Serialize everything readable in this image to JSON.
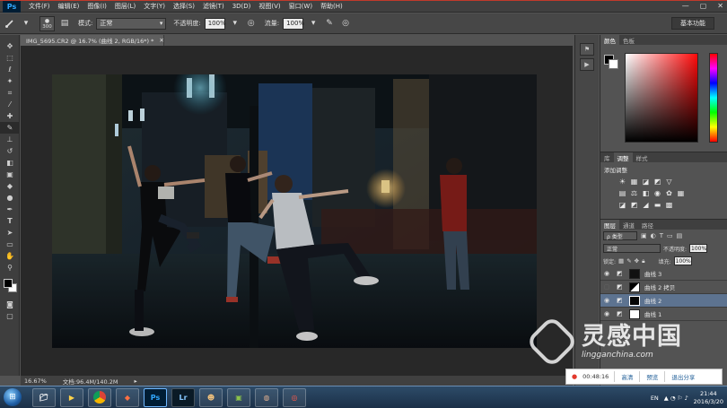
{
  "app": {
    "logo": "Ps"
  },
  "menu": [
    "文件(F)",
    "编辑(E)",
    "图像(I)",
    "图层(L)",
    "文字(Y)",
    "选择(S)",
    "滤镜(T)",
    "3D(D)",
    "视图(V)",
    "窗口(W)",
    "帮助(H)"
  ],
  "window_controls": [
    "—",
    "▢",
    "✕"
  ],
  "options_bar": {
    "brush_size": "300",
    "mode_label": "模式:",
    "mode_value": "正常",
    "opacity_label": "不透明度:",
    "opacity_value": "100%",
    "flow_label": "流量:",
    "flow_value": "100%",
    "workspace": "基本功能"
  },
  "document": {
    "tab_title": "IMG_5695.CR2 @ 16.7% (曲线 2, RGB/16*) *",
    "zoom": "16.67%",
    "doc_info": "文档:96.4M/140.2M"
  },
  "tools": [
    "move-tool",
    "marquee-tool",
    "lasso-tool",
    "quick-select-tool",
    "crop-tool",
    "eyedropper-tool",
    "healing-tool",
    "brush-tool",
    "stamp-tool",
    "history-brush-tool",
    "eraser-tool",
    "gradient-tool",
    "blur-tool",
    "dodge-tool",
    "pen-tool",
    "type-tool",
    "path-select-tool",
    "shape-tool",
    "hand-tool",
    "zoom-tool"
  ],
  "color_panel": {
    "tabs": [
      "颜色",
      "色板"
    ]
  },
  "adjust_panel": {
    "tabs": [
      "库",
      "调整",
      "样式"
    ],
    "title": "添加调整"
  },
  "layers_panel": {
    "tabs": [
      "图层",
      "通道",
      "路径"
    ],
    "filter_kind": "ρ 类型",
    "blend_mode": "正常",
    "opacity_label": "不透明度:",
    "opacity_value": "100%",
    "lock_label": "锁定:",
    "fill_label": "填充:",
    "fill_value": "100%",
    "layers": [
      {
        "name": "曲线 3",
        "visible": true,
        "selected": false
      },
      {
        "name": "曲线 2 拷贝",
        "visible": false,
        "selected": false
      },
      {
        "name": "曲线 2",
        "visible": true,
        "selected": true
      },
      {
        "name": "曲线 1",
        "visible": true,
        "selected": false
      }
    ]
  },
  "recorder": {
    "time": "00:48:16",
    "buttons": [
      "高清",
      "预览",
      "退出分享"
    ]
  },
  "taskbar": {
    "apps": [
      "explorer",
      "media",
      "chrome",
      "app",
      "Ps",
      "Lr",
      "app",
      "app",
      "app",
      "app"
    ],
    "tray_lang": "EN",
    "time": "21:44",
    "date": "2016/3/20"
  },
  "watermark": {
    "text_cn": "灵感中国",
    "url": "lingganchina.com"
  }
}
